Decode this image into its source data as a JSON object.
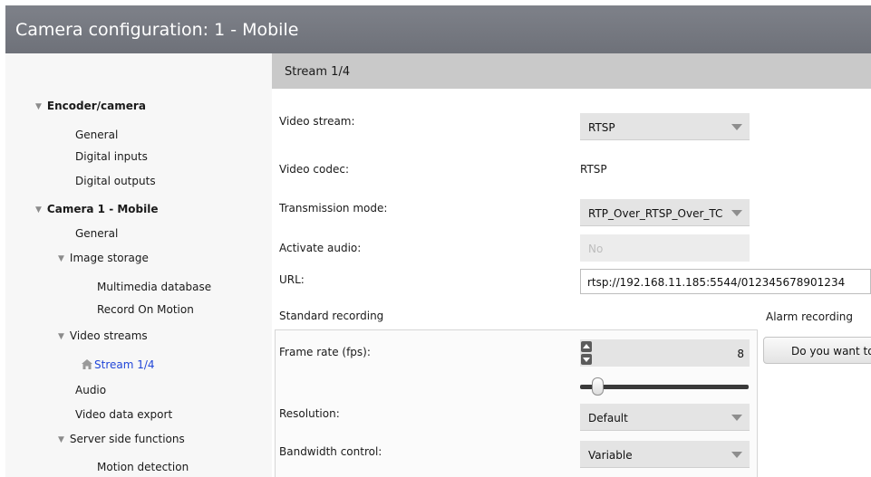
{
  "window": {
    "title": "Camera configuration: 1 - Mobile"
  },
  "sidebar": {
    "encoder": "Encoder/camera",
    "general_1": "General",
    "digital_inputs": "Digital inputs",
    "digital_outputs": "Digital outputs",
    "camera": "Camera 1 - Mobile",
    "general_2": "General",
    "image_storage": "Image storage",
    "multimedia_db": "Multimedia database",
    "record_on_motion": "Record On Motion",
    "video_streams": "Video streams",
    "stream": "Stream 1/4",
    "audio": "Audio",
    "video_export": "Video data export",
    "server_side": "Server side functions",
    "motion_detection": "Motion detection"
  },
  "header": {
    "section": "Stream 1/4"
  },
  "form": {
    "video_stream_label": "Video stream:",
    "video_stream_value": "RTSP",
    "video_codec_label": "Video codec:",
    "video_codec_value": "RTSP",
    "transmission_label": "Transmission mode:",
    "transmission_value": "RTP_Over_RTSP_Over_TC",
    "audio_label": "Activate audio:",
    "audio_value": "No",
    "url_label": "URL:",
    "url_value": "rtsp://192.168.11.185:5544/012345678901234"
  },
  "recording": {
    "standard_title": "Standard recording",
    "alarm_title": "Alarm recording",
    "frame_rate_label": "Frame rate (fps):",
    "frame_rate_value": "8",
    "resolution_label": "Resolution:",
    "resolution_value": "Default",
    "bandwidth_label": "Bandwidth control:",
    "bandwidth_value": "Variable",
    "alarm_button": "Do you want to"
  },
  "colors": {
    "titlebar": "#74777f",
    "active_link": "#2146d8",
    "header_bg": "#c9c9c9"
  }
}
